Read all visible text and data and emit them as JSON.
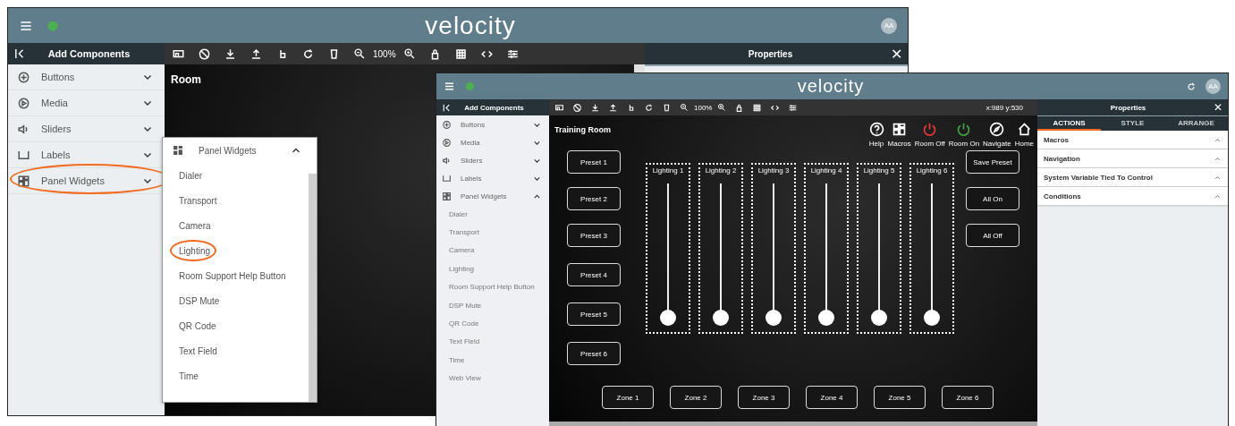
{
  "back_window": {
    "logo": "velocity",
    "avatar": "AA",
    "sidebar": {
      "title": "Add Components",
      "items": [
        {
          "label": "Buttons",
          "expanded": false,
          "circled": false
        },
        {
          "label": "Media",
          "expanded": false,
          "circled": false
        },
        {
          "label": "Sliders",
          "expanded": false,
          "circled": false
        },
        {
          "label": "Labels",
          "expanded": false,
          "circled": false
        },
        {
          "label": "Panel Widgets",
          "expanded": false,
          "circled": true
        }
      ]
    },
    "toolbar": {
      "zoom": "100%"
    },
    "canvas": {
      "title": "Room"
    },
    "popup": {
      "title": "Panel Widgets",
      "expanded": true,
      "items": [
        {
          "label": "Dialer",
          "circled": false
        },
        {
          "label": "Transport",
          "circled": false
        },
        {
          "label": "Camera",
          "circled": false
        },
        {
          "label": "Lighting",
          "circled": true
        },
        {
          "label": "Room Support Help Button",
          "circled": false
        },
        {
          "label": "DSP Mute",
          "circled": false
        },
        {
          "label": "QR Code",
          "circled": false
        },
        {
          "label": "Text Field",
          "circled": false
        },
        {
          "label": "Time",
          "circled": false
        }
      ]
    },
    "properties": {
      "title": "Properties",
      "close": "✕"
    }
  },
  "front_window": {
    "logo": "velocity",
    "avatar": "AA",
    "sidebar": {
      "title": "Add Components",
      "items": [
        {
          "label": "Buttons",
          "expanded": false
        },
        {
          "label": "Media",
          "expanded": false
        },
        {
          "label": "Sliders",
          "expanded": false
        },
        {
          "label": "Labels",
          "expanded": false
        },
        {
          "label": "Panel Widgets",
          "expanded": true,
          "children": [
            "Dialer",
            "Transport",
            "Camera",
            "Lighting",
            "Room Support Help Button",
            "DSP Mute",
            "QR Code",
            "Text Field",
            "Time",
            "Web View"
          ]
        }
      ]
    },
    "toolbar": {
      "zoom": "100%",
      "coordinates": "x:989 y:530"
    },
    "canvas": {
      "title": "Training Room",
      "actions": [
        {
          "label": "Help",
          "color": "#ffffff"
        },
        {
          "label": "Macros",
          "color": "#ffffff"
        },
        {
          "label": "Room Off",
          "color": "#e53935"
        },
        {
          "label": "Room On",
          "color": "#43a047"
        },
        {
          "label": "Navigate",
          "color": "#ffffff"
        },
        {
          "label": "Home",
          "color": "#ffffff"
        }
      ],
      "presets": [
        "Preset 1",
        "Preset 2",
        "Preset 3",
        "Preset 4",
        "Preset 5",
        "Preset 6"
      ],
      "sliders": [
        {
          "label": "Lighting 1",
          "level": 0
        },
        {
          "label": "Lighting 2",
          "level": 0
        },
        {
          "label": "Lighting 3",
          "level": 0
        },
        {
          "label": "Lighting 4",
          "level": 0
        },
        {
          "label": "Lighting 5",
          "level": 0
        },
        {
          "label": "Lighting 6",
          "level": 0
        }
      ],
      "side_buttons": [
        "Save Preset",
        "All On",
        "All Off"
      ],
      "zones": [
        "Zone 1",
        "Zone 2",
        "Zone 3",
        "Zone 4",
        "Zone 5",
        "Zone 6"
      ]
    },
    "properties": {
      "title": "Properties",
      "close": "✕",
      "tabs": [
        {
          "label": "ACTIONS",
          "selected": true
        },
        {
          "label": "STYLE",
          "selected": false
        },
        {
          "label": "ARRANGE",
          "selected": false
        }
      ],
      "sections": [
        {
          "label": "Macros",
          "expanded": true
        },
        {
          "label": "Navigation",
          "expanded": true
        },
        {
          "label": "System Variable Tied To Control",
          "expanded": true
        },
        {
          "label": "Conditions",
          "expanded": true
        }
      ]
    }
  }
}
